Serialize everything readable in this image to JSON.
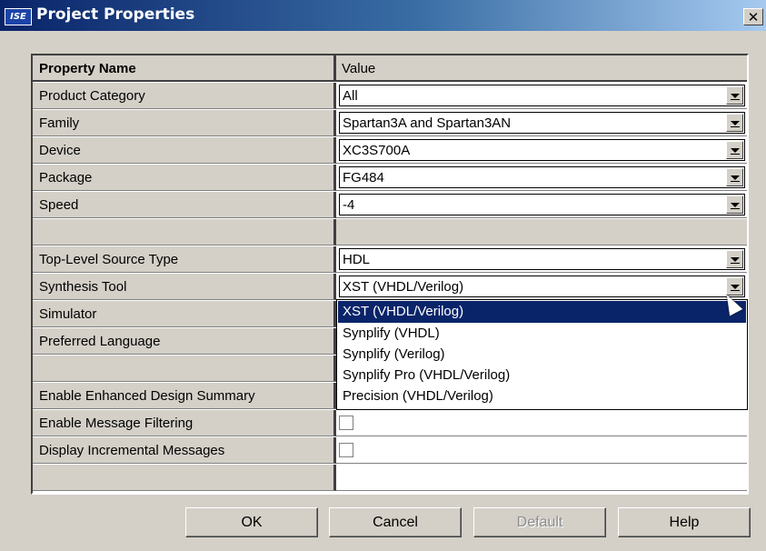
{
  "window": {
    "title": "Project Properties",
    "icon_label": "ISE",
    "close_label": "✕"
  },
  "table": {
    "header": {
      "name": "Property Name",
      "value": "Value"
    },
    "rows": [
      {
        "name": "Product Category",
        "value": "All"
      },
      {
        "name": "Family",
        "value": "Spartan3A and Spartan3AN"
      },
      {
        "name": "Device",
        "value": "XC3S700A"
      },
      {
        "name": "Package",
        "value": "FG484"
      },
      {
        "name": "Speed",
        "value": "-4"
      },
      {
        "name": "",
        "value": ""
      },
      {
        "name": "Top-Level Source Type",
        "value": "HDL"
      },
      {
        "name": "Synthesis Tool",
        "value": "XST (VHDL/Verilog)"
      },
      {
        "name": "Simulator",
        "value": ""
      },
      {
        "name": "Preferred Language",
        "value": ""
      },
      {
        "name": "",
        "value": ""
      },
      {
        "name": "Enable Enhanced Design Summary",
        "value": ""
      },
      {
        "name": "Enable Message Filtering",
        "value": ""
      },
      {
        "name": "Display Incremental Messages",
        "value": ""
      },
      {
        "name": "",
        "value": ""
      }
    ]
  },
  "dropdown": {
    "options": [
      "XST (VHDL/Verilog)",
      "Synplify (VHDL)",
      "Synplify (Verilog)",
      "Synplify Pro (VHDL/Verilog)",
      "Precision (VHDL/Verilog)"
    ],
    "selected": "XST (VHDL/Verilog)"
  },
  "buttons": {
    "ok": "OK",
    "cancel": "Cancel",
    "default": "Default",
    "help": "Help"
  },
  "colors": {
    "title_bar": "#0a246a",
    "selection": "#0a246a",
    "face": "#d4d0c8"
  }
}
